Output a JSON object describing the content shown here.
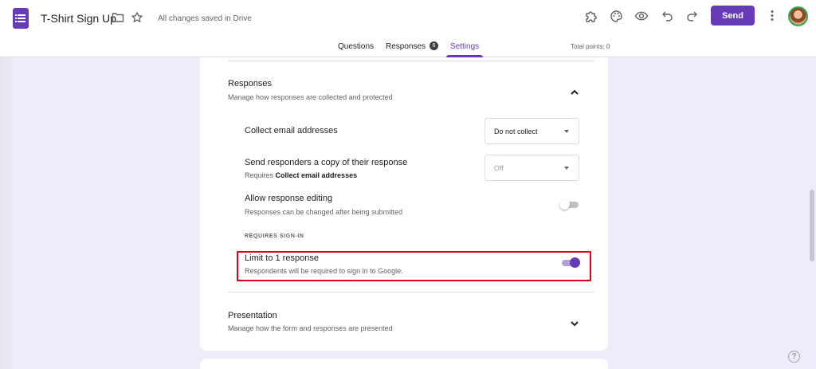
{
  "header": {
    "title": "T-Shirt Sign Up",
    "saved_status": "All changes saved in Drive",
    "send_label": "Send",
    "icons": {
      "app": "google-forms-icon",
      "folder": "folder-icon",
      "star": "star-icon",
      "addons": "puzzle-piece-icon",
      "palette": "palette-icon",
      "preview": "eye-icon",
      "undo": "undo-icon",
      "redo": "redo-icon",
      "more": "more-vert-icon"
    }
  },
  "tabs": {
    "questions": "Questions",
    "responses": "Responses",
    "responses_count": "6",
    "settings": "Settings",
    "active": "Settings"
  },
  "total_points": "Total points: 0",
  "responses_section": {
    "title": "Responses",
    "description": "Manage how responses are collected and protected",
    "collect_email": {
      "label": "Collect email addresses",
      "value": "Do not collect"
    },
    "send_copy": {
      "label": "Send responders a copy of their response",
      "sub_prefix": "Requires ",
      "sub_bold": "Collect email addresses",
      "value": "Off"
    },
    "allow_editing": {
      "label": "Allow response editing",
      "description": "Responses can be changed after being submitted",
      "enabled": false
    },
    "requires_signin_heading": "REQUIRES SIGN-IN",
    "limit_response": {
      "label": "Limit to 1 response",
      "description": "Respondents will be required to sign in to Google.",
      "enabled": true
    }
  },
  "presentation_section": {
    "title": "Presentation",
    "description": "Manage how the form and responses are presented"
  },
  "colors": {
    "accent": "#673ab7",
    "background": "#f0ebf8",
    "highlight": "#e0001b"
  }
}
